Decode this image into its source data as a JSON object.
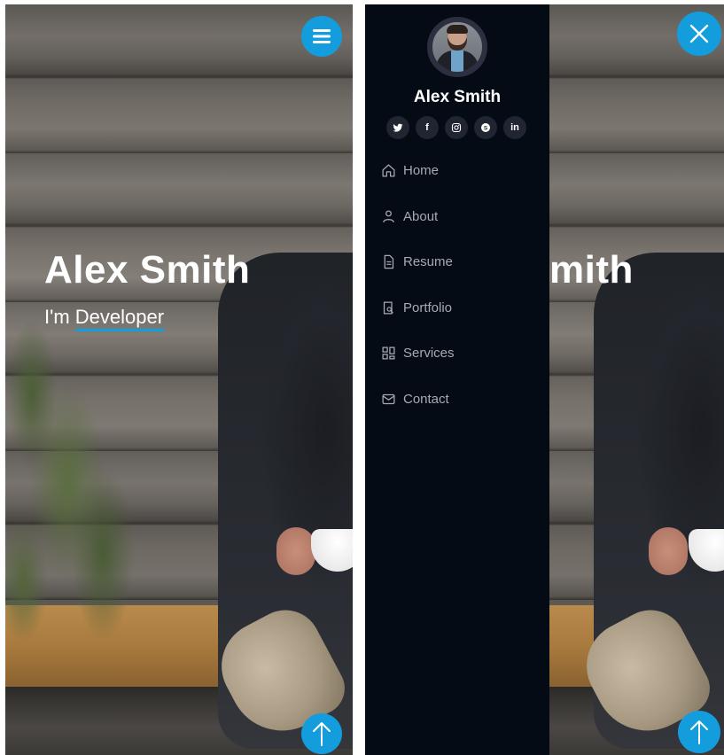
{
  "profile": {
    "name": "Alex Smith",
    "typed_prefix": "I'm",
    "typed_word": "Developer"
  },
  "hero_right_partial_name": "mith",
  "sidebar": {
    "name": "Alex Smith",
    "social": [
      {
        "name": "twitter",
        "glyph": "🐦"
      },
      {
        "name": "facebook",
        "glyph": "f"
      },
      {
        "name": "instagram",
        "glyph": "◎"
      },
      {
        "name": "skype",
        "glyph": "S"
      },
      {
        "name": "linkedin",
        "glyph": "in"
      }
    ],
    "nav": [
      {
        "label": "Home",
        "icon": "house-icon"
      },
      {
        "label": "About",
        "icon": "person-icon"
      },
      {
        "label": "Resume",
        "icon": "file-icon"
      },
      {
        "label": "Portfolio",
        "icon": "book-icon"
      },
      {
        "label": "Services",
        "icon": "grid-icon"
      },
      {
        "label": "Contact",
        "icon": "envelope-icon"
      }
    ]
  },
  "colors": {
    "accent": "#149ddd",
    "sidebar_bg": "#040b14",
    "nav_text": "#a8a9b4"
  }
}
